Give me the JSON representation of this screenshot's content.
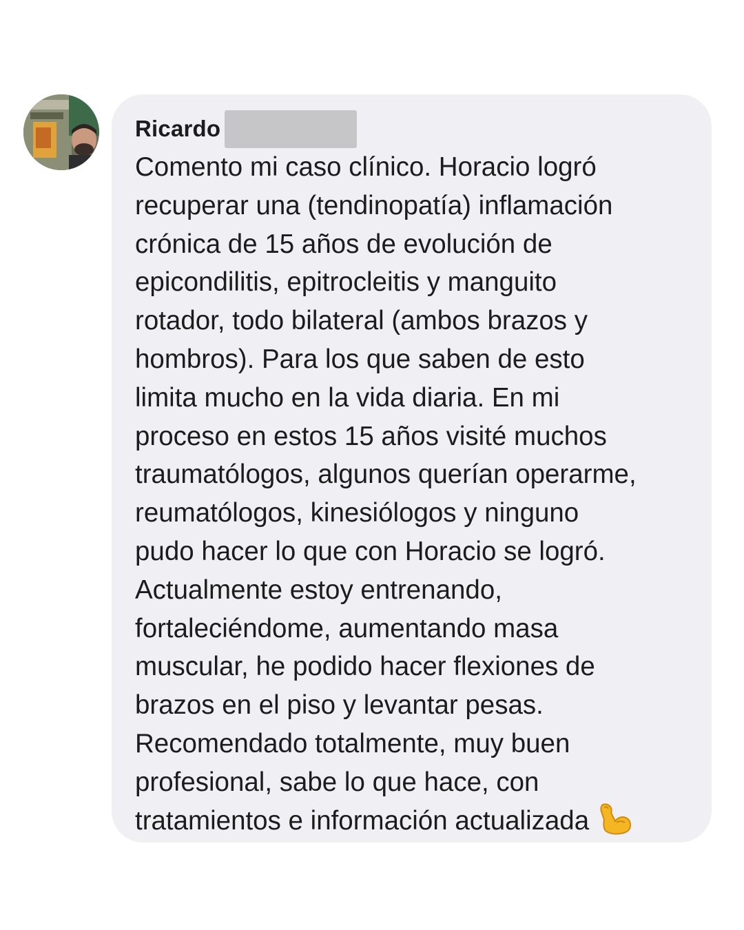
{
  "comment": {
    "author": "Ricardo",
    "lines": [
      "Comento mi caso clínico. Horacio logró",
      "recuperar una (tendinopatía) inflamación",
      "crónica de 15 años de evolución de",
      "epicondilitis, epitrocleitis y manguito",
      "rotador, todo bilateral (ambos brazos y",
      "hombros). Para los que saben de esto",
      "limita mucho en la vida diaria. En mi",
      "proceso en estos 15 años visité muchos",
      "traumatólogos, algunos querían operarme,",
      "reumatólogos, kinesiólogos y ninguno",
      "pudo hacer lo que con Horacio se logró.",
      "Actualmente estoy entrenando,",
      "fortaleciéndome, aumentando masa",
      "muscular, he podido hacer flexiones de",
      "brazos en el piso y levantar pesas.",
      "Recomendado totalmente, muy buen",
      "profesional, sabe lo que hace, con",
      "tratamientos e información actualizada"
    ],
    "emoji_icon": "flexed-biceps-icon",
    "colors": {
      "bubble": "#f0f0f4",
      "text": "#1c1c1e",
      "redaction": "#c6c6c8",
      "emoji": "#f5b623"
    }
  }
}
